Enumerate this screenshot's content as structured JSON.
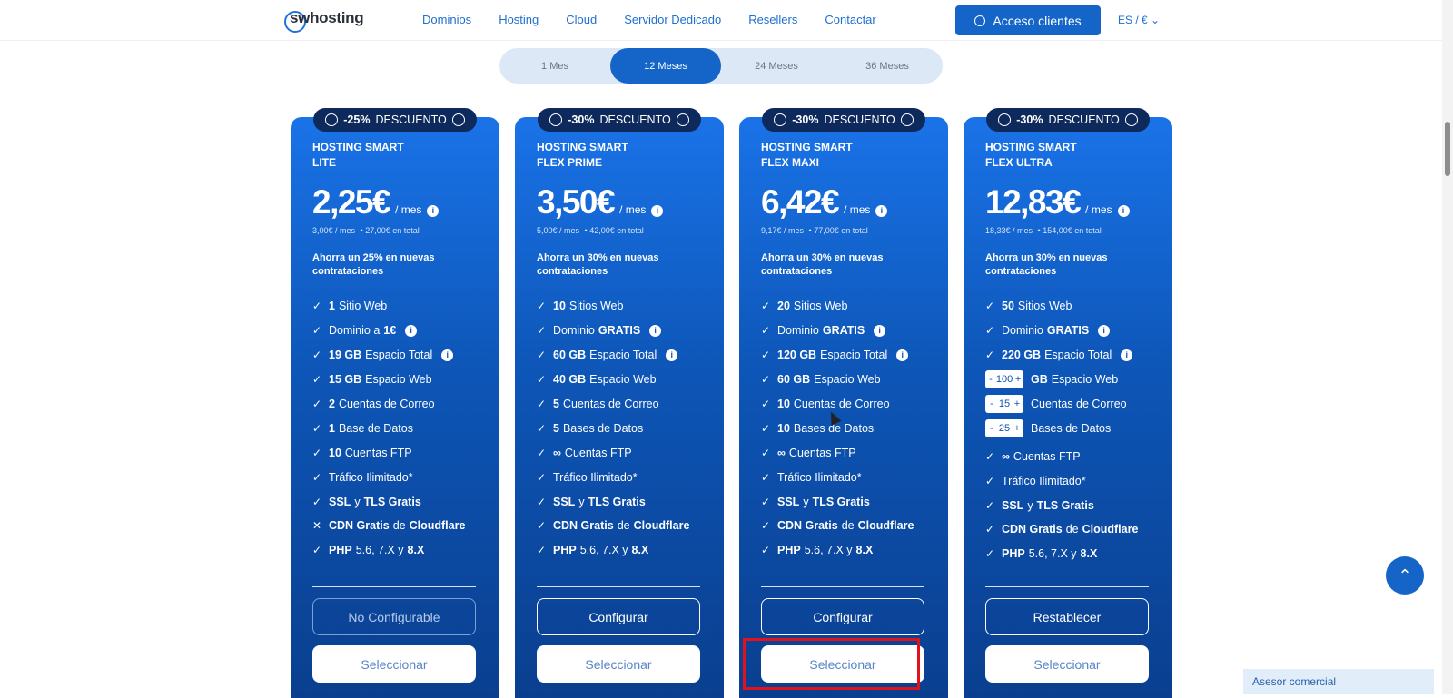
{
  "header": {
    "logo": "swhosting",
    "nav": [
      "Dominios",
      "Hosting",
      "Cloud",
      "Servidor Dedicado",
      "Resellers",
      "Contactar"
    ],
    "acceso_label": "Acceso clientes",
    "lang": "ES / € ⌄"
  },
  "periods": [
    "1 Mes",
    "12 Meses",
    "24 Meses",
    "36 Meses"
  ],
  "active_period": "12 Meses",
  "plans": [
    {
      "badge_pct": "-25%",
      "badge_text": "DESCUENTO",
      "name1": "HOSTING SMART",
      "name2": "LITE",
      "price": "2,25€",
      "per": "/ mes",
      "old": "3,00€ / mes",
      "total": "27,00€ en total",
      "ahorra": "Ahorra un 25% en nuevas contrataciones",
      "f": [
        [
          "1",
          "Sitio Web"
        ],
        [
          "Dominio a",
          "1€"
        ],
        [
          "19 GB",
          "Espacio Total"
        ],
        [
          "15 GB",
          "Espacio Web"
        ],
        [
          "2",
          "Cuentas de Correo"
        ],
        [
          "1",
          "Base de Datos"
        ],
        [
          "10",
          "Cuentas FTP"
        ],
        [
          "Tráfico Ilimitado*",
          ""
        ],
        [
          "SSL",
          "y",
          "TLS Gratis"
        ],
        [
          "CDN Gratis",
          "de",
          "Cloudflare"
        ],
        [
          "PHP",
          "5.6, 7.X y",
          "8.X"
        ]
      ],
      "btn1": "No Configurable",
      "btn2": "Seleccionar"
    },
    {
      "badge_pct": "-30%",
      "badge_text": "DESCUENTO",
      "name1": "HOSTING SMART",
      "name2": "FLEX PRIME",
      "price": "3,50€",
      "per": "/ mes",
      "old": "5,00€ / mes",
      "total": "42,00€ en total",
      "ahorra": "Ahorra un 30% en nuevas contrataciones",
      "f": [
        [
          "10",
          "Sitios Web"
        ],
        [
          "Dominio",
          "GRATIS"
        ],
        [
          "60 GB",
          "Espacio Total"
        ],
        [
          "40 GB",
          "Espacio Web"
        ],
        [
          "5",
          "Cuentas de Correo"
        ],
        [
          "5",
          "Bases de Datos"
        ],
        [
          "∞",
          "Cuentas FTP"
        ],
        [
          "Tráfico Ilimitado*",
          ""
        ],
        [
          "SSL",
          "y",
          "TLS Gratis"
        ],
        [
          "CDN Gratis",
          "de",
          "Cloudflare"
        ],
        [
          "PHP",
          "5.6, 7.X y",
          "8.X"
        ]
      ],
      "btn1": "Configurar",
      "btn2": "Seleccionar"
    },
    {
      "badge_pct": "-30%",
      "badge_text": "DESCUENTO",
      "name1": "HOSTING SMART",
      "name2": "FLEX MAXI",
      "price": "6,42€",
      "per": "/ mes",
      "old": "9,17€ / mes",
      "total": "77,00€ en total",
      "ahorra": "Ahorra un 30% en nuevas contrataciones",
      "f": [
        [
          "20",
          "Sitios Web"
        ],
        [
          "Dominio",
          "GRATIS"
        ],
        [
          "120 GB",
          "Espacio Total"
        ],
        [
          "60 GB",
          "Espacio Web"
        ],
        [
          "10",
          "Cuentas de Correo"
        ],
        [
          "10",
          "Bases de Datos"
        ],
        [
          "∞",
          "Cuentas FTP"
        ],
        [
          "Tráfico Ilimitado*",
          ""
        ],
        [
          "SSL",
          "y",
          "TLS Gratis"
        ],
        [
          "CDN Gratis",
          "de",
          "Cloudflare"
        ],
        [
          "PHP",
          "5.6, 7.X y",
          "8.X"
        ]
      ],
      "btn1": "Configurar",
      "btn2": "Seleccionar"
    },
    {
      "badge_pct": "-30%",
      "badge_text": "DESCUENTO",
      "name1": "HOSTING SMART",
      "name2": "FLEX ULTRA",
      "price": "12,83€",
      "per": "/ mes",
      "old": "18,33€ / mes",
      "total": "154,00€ en total",
      "ahorra": "Ahorra un 30% en nuevas contrataciones",
      "f": [
        [
          "50",
          "Sitios Web"
        ],
        [
          "Dominio",
          "GRATIS"
        ],
        [
          "220 GB",
          "Espacio Total"
        ],
        [
          "100",
          "GB",
          "Espacio Web"
        ],
        [
          "15",
          "Cuentas de Correo"
        ],
        [
          "25",
          "Bases de Datos"
        ],
        [
          "∞",
          "Cuentas FTP"
        ],
        [
          "Tráfico Ilimitado*",
          ""
        ],
        [
          "SSL",
          "y",
          "TLS Gratis"
        ],
        [
          "CDN Gratis",
          "de",
          "Cloudflare"
        ],
        [
          "PHP",
          "5.6, 7.X y",
          "8.X"
        ]
      ],
      "btn1": "Restablecer",
      "btn2": "Seleccionar"
    }
  ],
  "asesor": "Asesor comercial",
  "colors": {
    "primary": "#1565c8",
    "badge": "#0e2a5c",
    "highlight": "#e0121b"
  }
}
